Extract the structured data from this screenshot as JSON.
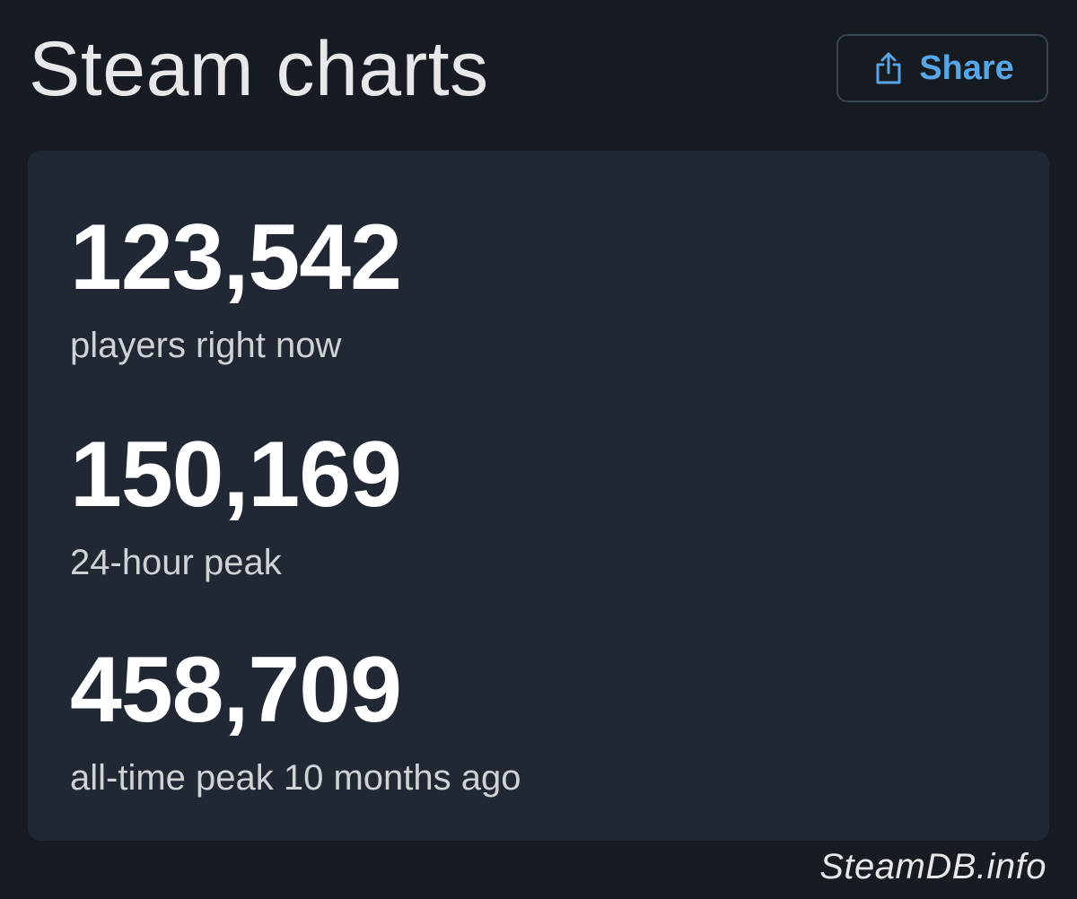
{
  "header": {
    "title": "Steam charts",
    "share_label": "Share",
    "share_icon": "share-icon",
    "accent_color": "#58a6e6"
  },
  "stats": [
    {
      "value": "123,542",
      "label": "players right now"
    },
    {
      "value": "150,169",
      "label": "24-hour peak"
    },
    {
      "value": "458,709",
      "label": "all-time peak 10 months ago"
    }
  ],
  "watermark": "SteamDB.info"
}
